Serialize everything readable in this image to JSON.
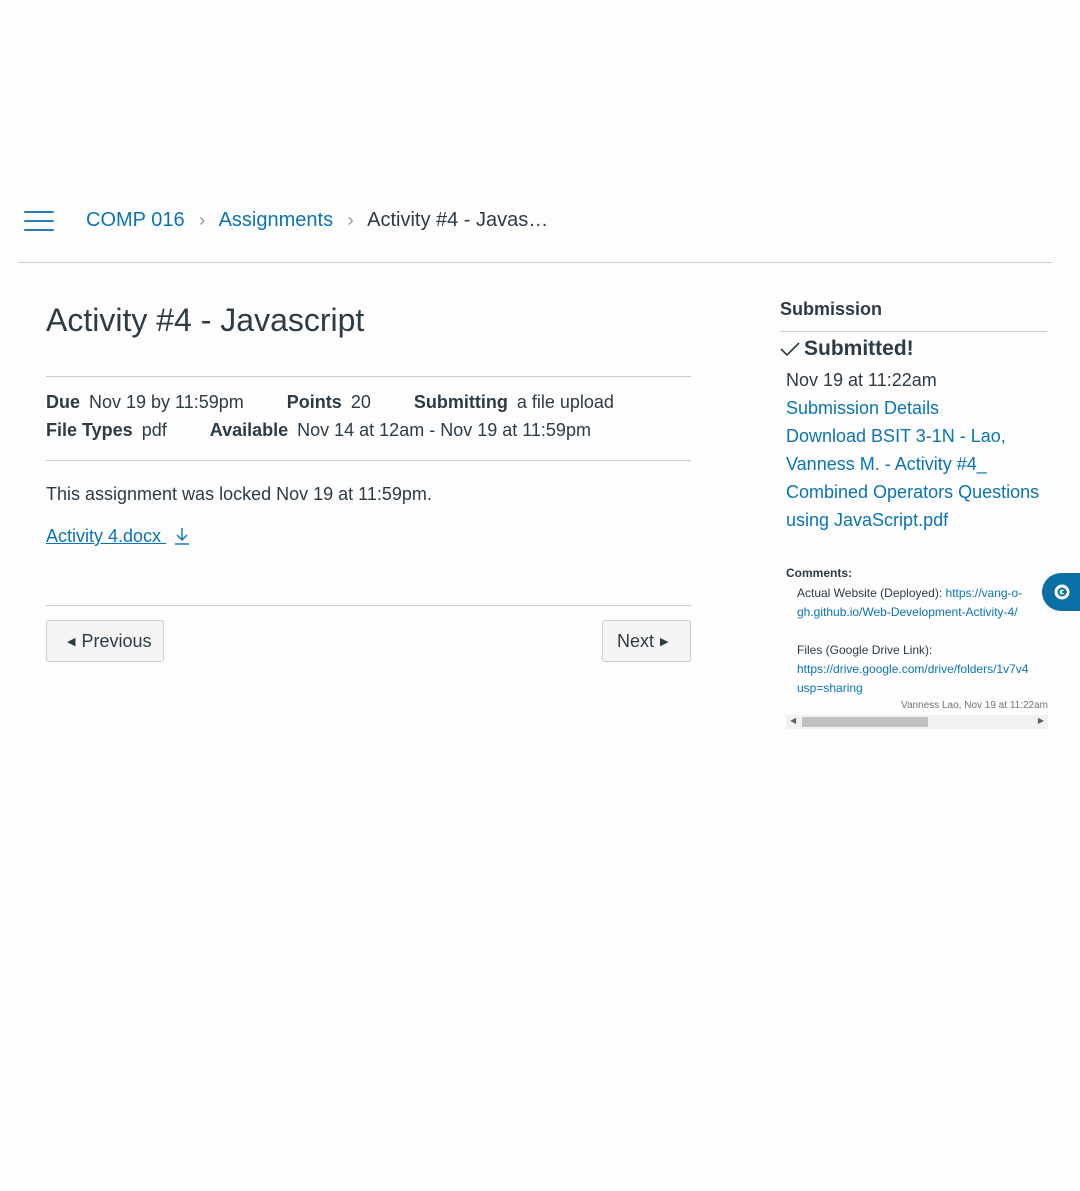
{
  "breadcrumb": {
    "course": "COMP 016",
    "section": "Assignments",
    "current": "Activity #4 - Javas…",
    "separator": "›"
  },
  "assignment": {
    "title": "Activity #4 - Javascript",
    "due_label": "Due",
    "due_value": "Nov 19 by 11:59pm",
    "points_label": "Points",
    "points_value": "20",
    "submitting_label": "Submitting",
    "submitting_value": "a file upload",
    "file_types_label": "File Types",
    "file_types_value": "pdf",
    "available_label": "Available",
    "available_value": "Nov 14 at 12am - Nov 19 at 11:59pm",
    "locked_notice": "This assignment was locked Nov 19 at 11:59pm.",
    "attachment": "Activity 4.docx"
  },
  "nav": {
    "previous": "Previous",
    "next": "Next"
  },
  "submission": {
    "heading": "Submission",
    "status": "Submitted!",
    "timestamp": "Nov 19 at 11:22am",
    "details_link": "Submission Details",
    "download_link": "Download BSIT 3-1N - Lao, Vanness M. - Activity #4_ Combined Operators Questions using JavaScript.pdf",
    "comments_label": "Comments:",
    "comment_line1_prefix": "Actual Website (Deployed): ",
    "comment_line1_link": "https://vang-o-gh.github.io/Web-Development-Activity-4/",
    "comment_line2": "Files (Google Drive Link):",
    "comment_line2_link": "https://drive.google.com/drive/folders/1v7v4",
    "comment_line2_link_cont": "usp=sharing",
    "comment_author": "Vanness Lao, Nov 19 at 11:22am"
  },
  "colors": {
    "link": "#0b74b4",
    "text": "#2d3b45",
    "floating_button": "#0b6fa6"
  }
}
